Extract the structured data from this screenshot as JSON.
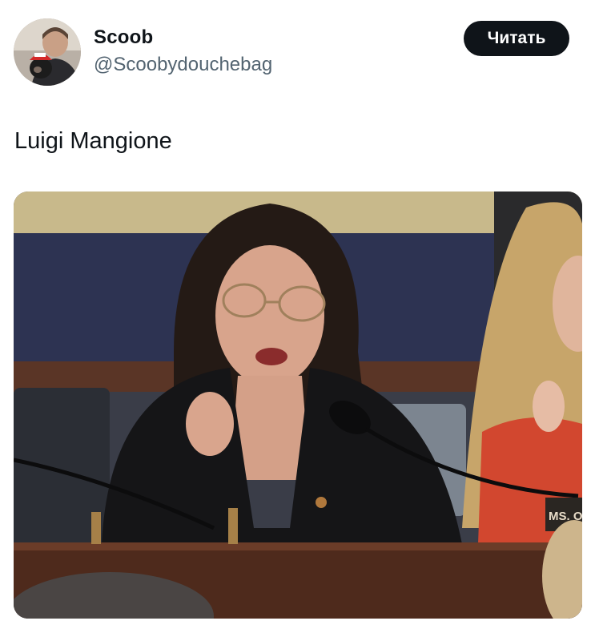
{
  "tweet": {
    "author": {
      "display_name": "Scoob",
      "handle": "@Scoobydouchebag",
      "avatar_icon": "profile-photo-person-with-dog"
    },
    "follow_button_label": "Читать",
    "text": "Luigi Mangione",
    "media": {
      "nameplate_text": "MS. O"
    }
  },
  "colors": {
    "text_primary": "#0f1419",
    "text_secondary": "#536471",
    "button_bg": "#0f1419",
    "button_text": "#ffffff"
  }
}
